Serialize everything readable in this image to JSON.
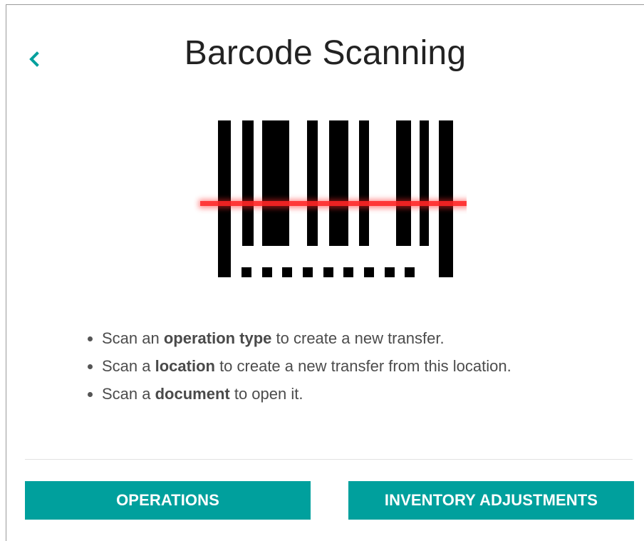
{
  "header": {
    "back_icon": "chevron-left-icon",
    "title": "Barcode Scanning"
  },
  "illustration": {
    "icon": "barcode-scanner-icon",
    "scan_line_color": "#ff2020"
  },
  "instructions": [
    {
      "prefix": "Scan an ",
      "bold": "operation type",
      "suffix": " to create a new transfer."
    },
    {
      "prefix": "Scan a ",
      "bold": "location",
      "suffix": " to create a new transfer from this location."
    },
    {
      "prefix": "Scan a ",
      "bold": "document",
      "suffix": " to open it."
    }
  ],
  "actions": {
    "operations_label": "OPERATIONS",
    "inventory_label": "INVENTORY ADJUSTMENTS"
  },
  "colors": {
    "accent": "#00a09d",
    "back_icon": "#00a09d",
    "title_text": "#222222"
  }
}
